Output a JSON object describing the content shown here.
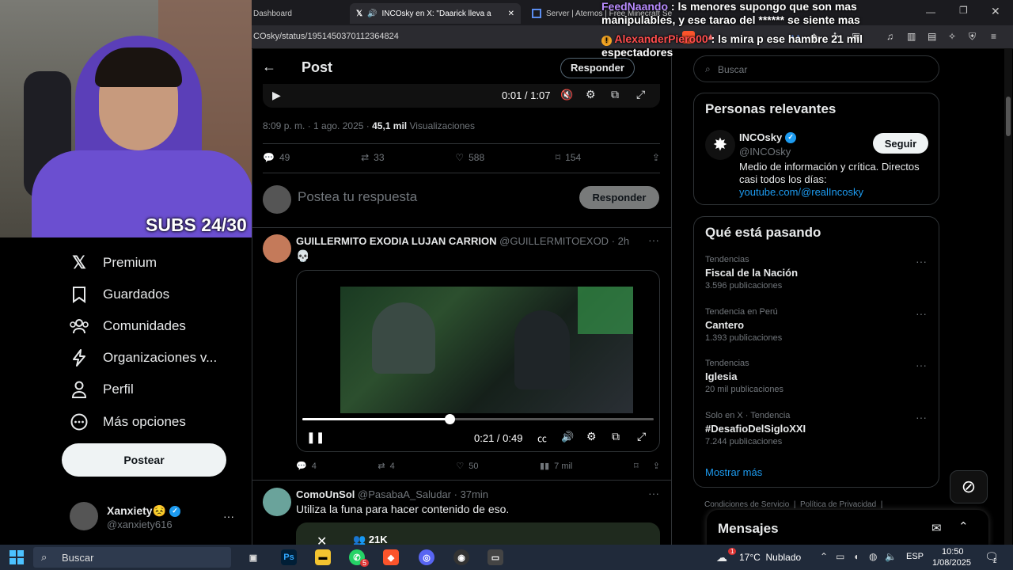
{
  "browser": {
    "tabs": [
      {
        "title": "Dashboard"
      },
      {
        "title": "INCOsky en X: \"Daarick lleva a"
      },
      {
        "title": "Server | Aternos | Free Minecraft Se"
      }
    ],
    "url": "COsky/status/1951450370112364824"
  },
  "chat": {
    "line1_user": "FeedNaando",
    "line1_text": ": ls menores supongo que son mas manipulables, y ese tarao del ****** se siente mas",
    "line2_user": "AlexanderPiero00",
    "line2_text": ": ls mira p ese hambre",
    "line2_tail": "21 mil espectadores"
  },
  "stream": {
    "subs": "SUBS 24/30"
  },
  "nav": {
    "items": [
      {
        "label": "Premium",
        "icon": "x-logo-icon"
      },
      {
        "label": "Guardados",
        "icon": "bookmark-icon"
      },
      {
        "label": "Comunidades",
        "icon": "communities-icon"
      },
      {
        "label": "Organizaciones v..."
      },
      {
        "label": "Perfil",
        "icon": "profile-icon"
      },
      {
        "label": "Más opciones",
        "icon": "more-options-icon"
      }
    ],
    "post_button": "Postear",
    "user": {
      "name": "Xanxiety😣",
      "handle": "@xanxiety616"
    }
  },
  "header": {
    "title": "Post",
    "reply_button": "Responder"
  },
  "top_video": {
    "time": "0:01 / 1:07"
  },
  "post_meta": {
    "datetime": "8:09 p. m. · 1 ago. 2025 · ",
    "views": "45,1 mil",
    "views_label": " Visualizaciones"
  },
  "post_stats": {
    "replies": "49",
    "reposts": "33",
    "likes": "588",
    "bookmarks": "154"
  },
  "composer": {
    "placeholder": "Postea tu respuesta",
    "button": "Responder"
  },
  "reply1": {
    "name": "GUILLERMITO EXODIA LUJAN CARRION",
    "handle": "@GUILLERMITOEXOD",
    "time": "· 2h",
    "text": "💀",
    "video_time": "0:21 / 0:49",
    "video_progress": 0.42,
    "stats": {
      "replies": "4",
      "reposts": "4",
      "likes": "50",
      "views": "7 mil"
    }
  },
  "reply2": {
    "name": "ComoUnSol",
    "handle": "@PasabaA_Saludar",
    "time": "· 37min",
    "text": "Utiliza la funa para hacer contenido de eso.",
    "overlay_count": "21K"
  },
  "search": {
    "placeholder": "Buscar"
  },
  "relevant": {
    "title": "Personas relevantes",
    "name": "INCOsky",
    "handle": "@INCOsky",
    "follow": "Seguir",
    "bio": "Medio de información y crítica. Directos casi todos los días:",
    "link": "youtube.com/@realIncosky"
  },
  "trending": {
    "title": "Qué está pasando",
    "items": [
      {
        "category": "Tendencias",
        "name": "Fiscal de la Nación",
        "count": "3.596 publicaciones"
      },
      {
        "category": "Tendencia en Perú",
        "name": "Cantero",
        "count": "1.393 publicaciones"
      },
      {
        "category": "Tendencias",
        "name": "Iglesia",
        "count": "20 mil publicaciones"
      },
      {
        "category": "Solo en X · Tendencia",
        "name": "#DesafioDelSigloXXI",
        "count": "7.244 publicaciones"
      }
    ],
    "show_more": "Mostrar más"
  },
  "footer_links": [
    "Condiciones de Servicio",
    "Política de Privacidad"
  ],
  "messages": {
    "title": "Mensajes"
  },
  "taskbar": {
    "search": "Buscar",
    "weather": "17°C  Nublado",
    "lang": "ESP",
    "time": "10:50",
    "date": "1/08/2025",
    "badge_whatsapp": "5",
    "badge_weather": "1",
    "badge_notif": "2"
  },
  "colors": {
    "accent": "#1d9bf0",
    "bg": "#000000",
    "border": "#2f3336",
    "muted": "#71767b",
    "chat_user1": "#b98cff",
    "chat_user2": "#ff4d4d"
  }
}
